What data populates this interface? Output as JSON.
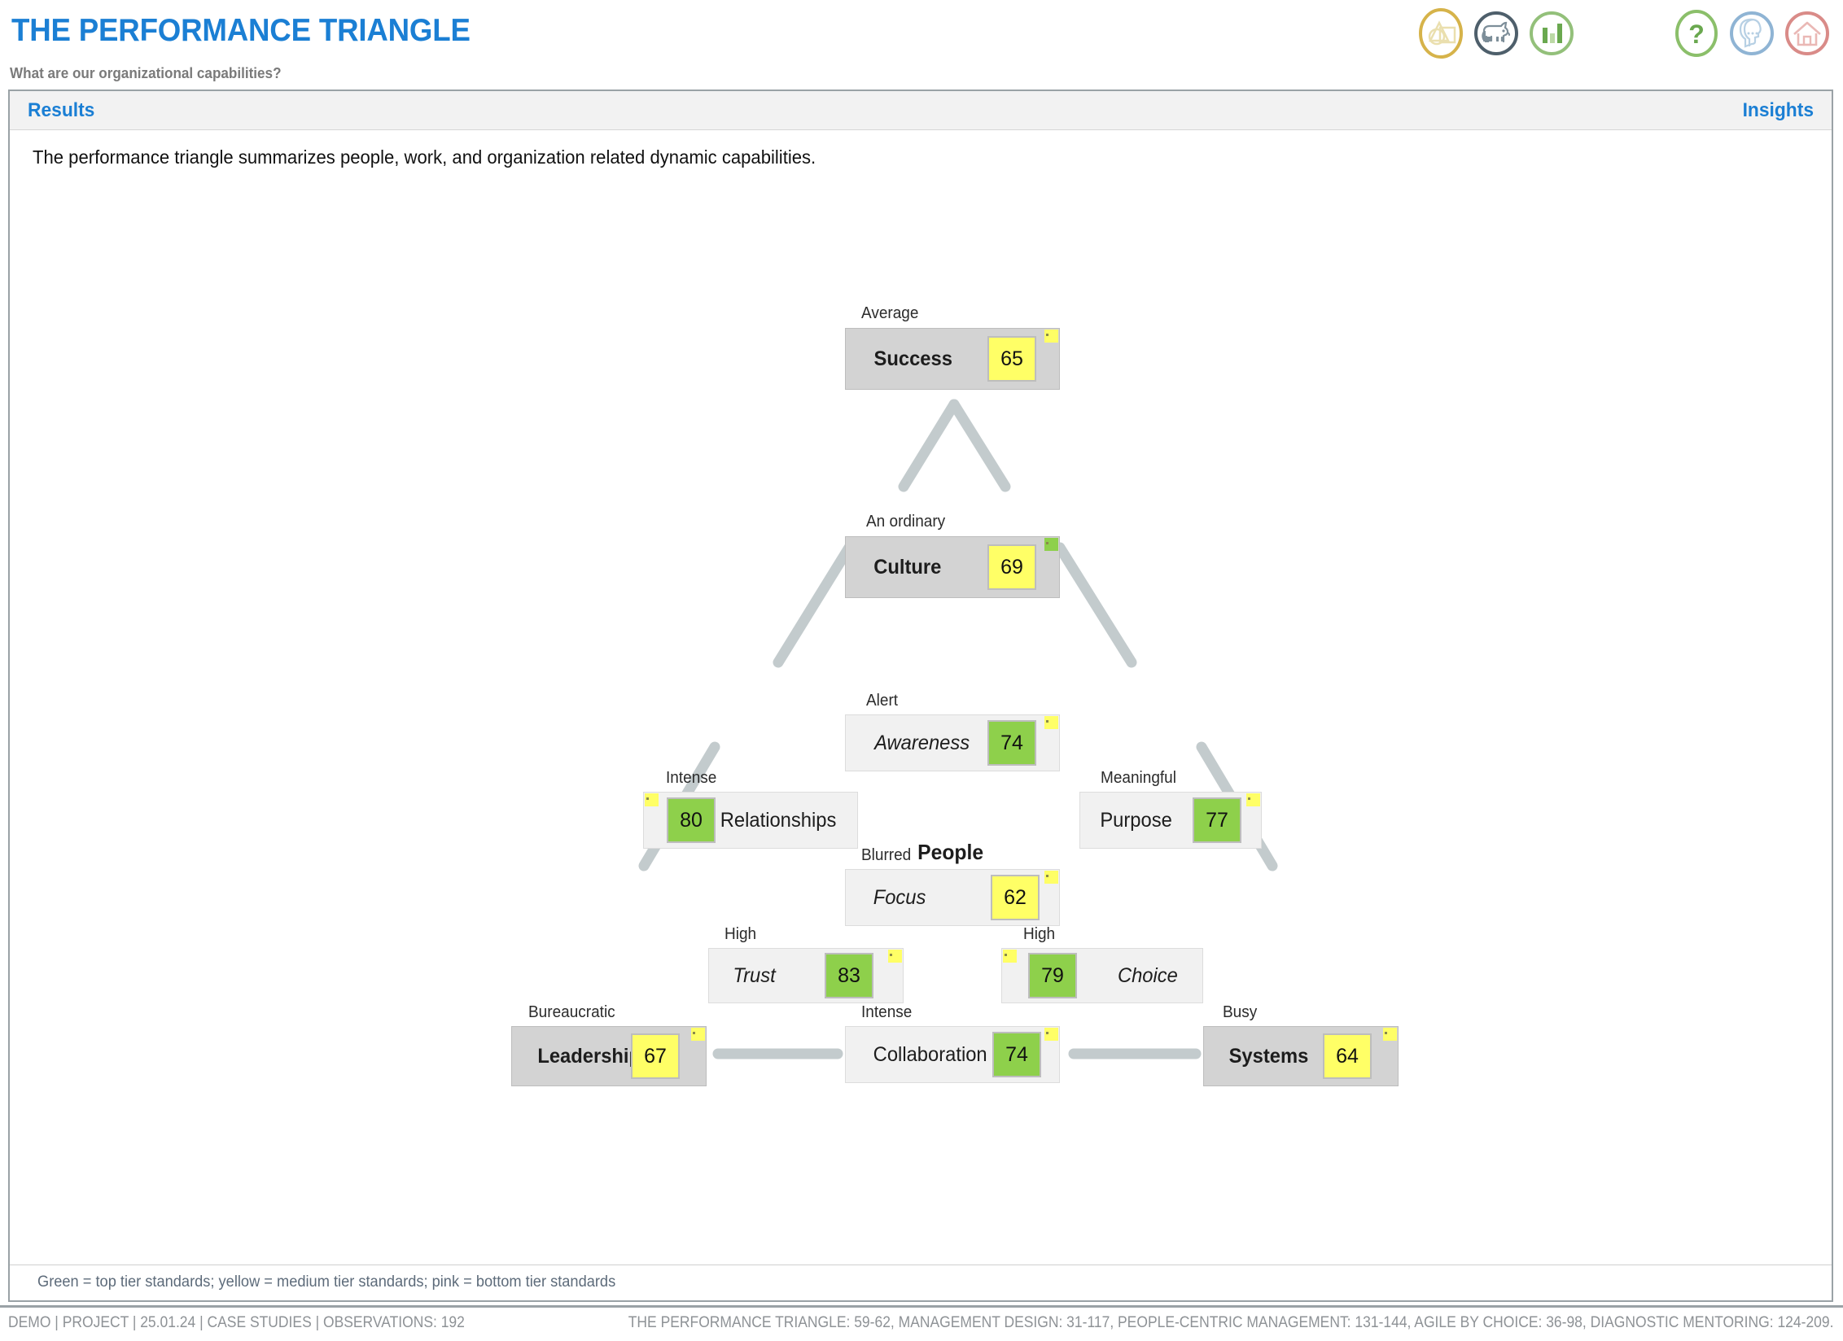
{
  "header": {
    "title": "THE PERFORMANCE TRIANGLE",
    "subtitle": "What are our organizational capabilities?",
    "icons": [
      {
        "name": "shapes-icon",
        "color": "#d6b34a"
      },
      {
        "name": "dog-icon",
        "color": "#4e5f6b"
      },
      {
        "name": "bar-chart-icon",
        "color": "#93c07a"
      },
      {
        "name": "question-mark-icon",
        "color": "#8bbf6a"
      },
      {
        "name": "head-profile-icon",
        "color": "#8fb4d4"
      },
      {
        "name": "home-icon",
        "color": "#d98b88"
      }
    ]
  },
  "tabs": {
    "results_label": "Results",
    "insights_label": "Insights",
    "accent_color": "#1b7fd4"
  },
  "lead_text": "The performance triangle summarizes people, work, and organization related dynamic capabilities.",
  "center_label": "People",
  "legend": "Green = top tier standards; yellow = medium tier standards; pink = bottom tier standards",
  "footer": {
    "left": "DEMO | PROJECT | 25.01.24 | CASE STUDIES | OBSERVATIONS: 192",
    "right": "THE PERFORMANCE TRIANGLE: 59-62, MANAGEMENT DESIGN: 31-117, PEOPLE-CENTRIC MANAGEMENT: 131-144, AGILE BY CHOICE: 36-98, DIAGNOSTIC MENTORING: 124-209."
  },
  "colors": {
    "green": "#8ed04b",
    "yellow": "#ffff66",
    "pink": "#f7b8c8",
    "connector": "#c3cbcd",
    "box_dark": "#d3d3d3",
    "box_light": "#f1f1f1"
  },
  "chart_data": {
    "type": "diagram",
    "title": "The Performance Triangle",
    "scale": "0-100 index score",
    "nodes": [
      {
        "id": "success",
        "caption": "Average",
        "label": "Success",
        "value": 65,
        "badge_color": "yellow",
        "corner_color": "yellow",
        "style": "dark",
        "emphasis": "bold",
        "badge_side": "right"
      },
      {
        "id": "culture",
        "caption": "An ordinary",
        "label": "Culture",
        "value": 69,
        "badge_color": "yellow",
        "corner_color": "green",
        "style": "dark",
        "emphasis": "bold",
        "badge_side": "right"
      },
      {
        "id": "awareness",
        "caption": "Alert",
        "label": "Awareness",
        "value": 74,
        "badge_color": "green",
        "corner_color": "yellow",
        "style": "light",
        "emphasis": "italic",
        "badge_side": "right"
      },
      {
        "id": "relationships",
        "caption": "Intense",
        "label": "Relationships",
        "value": 80,
        "badge_color": "green",
        "corner_color": "yellow",
        "style": "light",
        "emphasis": "regular",
        "badge_side": "left"
      },
      {
        "id": "purpose",
        "caption": "Meaningful",
        "label": "Purpose",
        "value": 77,
        "badge_color": "green",
        "corner_color": "yellow",
        "style": "light",
        "emphasis": "regular",
        "badge_side": "right"
      },
      {
        "id": "focus",
        "caption": "Blurred",
        "label": "Focus",
        "value": 62,
        "badge_color": "yellow",
        "corner_color": "yellow",
        "style": "light",
        "emphasis": "italic",
        "badge_side": "right"
      },
      {
        "id": "trust",
        "caption": "High",
        "label": "Trust",
        "value": 83,
        "badge_color": "green",
        "corner_color": "yellow",
        "style": "light",
        "emphasis": "italic",
        "badge_side": "right"
      },
      {
        "id": "choice",
        "caption": "High",
        "label": "Choice",
        "value": 79,
        "badge_color": "green",
        "corner_color": "yellow",
        "style": "light",
        "emphasis": "italic",
        "badge_side": "left"
      },
      {
        "id": "leadership",
        "caption": "Bureaucratic",
        "label": "Leadership",
        "value": 67,
        "badge_color": "yellow",
        "corner_color": "yellow",
        "style": "dark",
        "emphasis": "bold",
        "badge_side": "right"
      },
      {
        "id": "collaboration",
        "caption": "Intense",
        "label": "Collaboration",
        "value": 74,
        "badge_color": "green",
        "corner_color": "yellow",
        "style": "light",
        "emphasis": "regular",
        "badge_side": "right"
      },
      {
        "id": "systems",
        "caption": "Busy",
        "label": "Systems",
        "value": 64,
        "badge_color": "yellow",
        "corner_color": "yellow",
        "style": "dark",
        "emphasis": "bold",
        "badge_side": "right"
      }
    ],
    "edges": [
      {
        "from": "culture",
        "to": "success",
        "kind": "chevron-left"
      },
      {
        "from": "culture",
        "to": "success",
        "kind": "chevron-right"
      },
      {
        "from": "culture",
        "to": "leadership",
        "kind": "diagonal"
      },
      {
        "from": "culture",
        "to": "systems",
        "kind": "diagonal"
      },
      {
        "from": "relationships",
        "to": "leadership",
        "kind": "diagonal"
      },
      {
        "from": "purpose",
        "to": "systems",
        "kind": "diagonal"
      },
      {
        "from": "leadership",
        "to": "collaboration",
        "kind": "horizontal"
      },
      {
        "from": "collaboration",
        "to": "systems",
        "kind": "horizontal"
      }
    ]
  }
}
